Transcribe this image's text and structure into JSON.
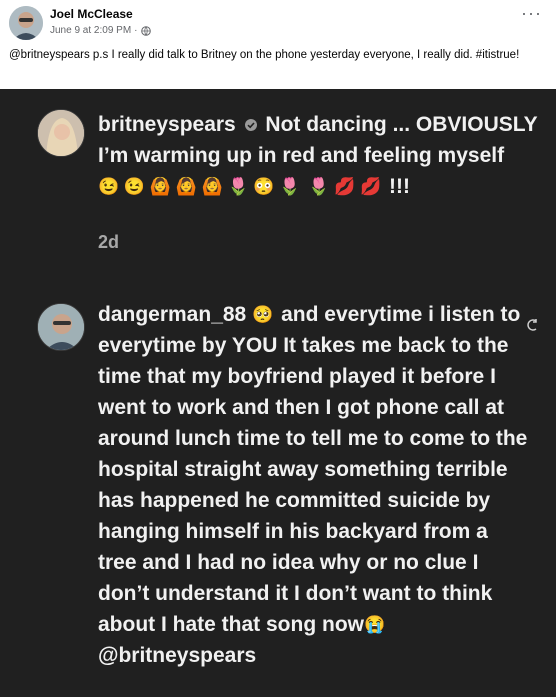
{
  "post": {
    "author": "Joel McClease",
    "timestamp": "June 9 at 2:09 PM",
    "separator": "·",
    "caption": "@britneyspears p.s I really did talk to Britney on the phone yesterday everyone, I really did. #itistrue!"
  },
  "instagram": {
    "comment1": {
      "username": "britneyspears",
      "text": "Not dancing ... OBVIOUSLY I’m warming up in red and feeling myself",
      "emojis_line1": "😉 😉 🙆 🙆 🙆 🌷 😳 🌷",
      "emojis_line2": "🌷 💋 💋",
      "trailing": "!!!",
      "age": "2d"
    },
    "comment2": {
      "username": "dangerman_88",
      "lead_emoji": "🥺",
      "text": "and everytime i listen to everytime by YOU It takes me back to the time that my boyfriend played it before I went to work and then I got phone call at around lunch time to tell me to come to the hospital straight away something terrible has happened he committed suicide by hanging himself in his backyard from a tree and I had no idea why or no clue I don’t understand it I don’t want to think about I hate that song now",
      "end_emoji": "😭",
      "mention": "@britneyspears"
    }
  },
  "colors": {
    "screenshot_bg": "#202020",
    "ig_text": "#f1f1f1",
    "ig_meta": "#a8a8a8",
    "fb_meta": "#65676b"
  }
}
